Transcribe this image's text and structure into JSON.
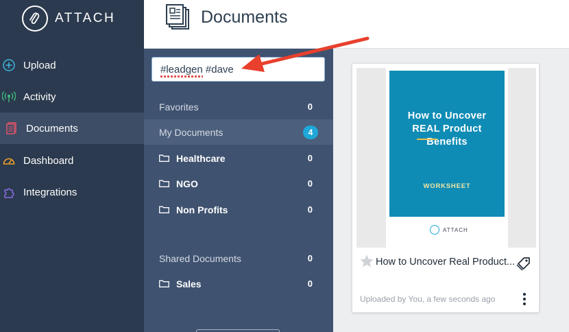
{
  "brand": {
    "name": "ATTACH"
  },
  "nav": {
    "items": [
      {
        "label": "Upload",
        "icon": "plus-circle-icon"
      },
      {
        "label": "Activity",
        "icon": "broadcast-icon"
      },
      {
        "label": "Documents",
        "icon": "documents-icon"
      },
      {
        "label": "Dashboard",
        "icon": "gauge-icon"
      },
      {
        "label": "Integrations",
        "icon": "puzzle-icon"
      }
    ],
    "active": "Documents"
  },
  "header": {
    "title": "Documents",
    "icon": "documents-stack-icon"
  },
  "search": {
    "value": "#leadgen #dave"
  },
  "sidebar": {
    "favorites": {
      "label": "Favorites",
      "count": "0"
    },
    "my_documents": {
      "label": "My Documents",
      "count": "4"
    },
    "folders": [
      {
        "label": "Healthcare",
        "count": "0"
      },
      {
        "label": "NGO",
        "count": "0"
      },
      {
        "label": "Non Profits",
        "count": "0"
      }
    ],
    "shared_documents": {
      "label": "Shared Documents",
      "count": "0"
    },
    "shared_folders": [
      {
        "label": "Sales",
        "count": "0"
      }
    ]
  },
  "document_card": {
    "cover": {
      "title_line1": "How to Uncover",
      "title_line2": "REAL Product",
      "title_line3": "Benefits",
      "subtitle": "WORKSHEET",
      "brand": "ATTACH"
    },
    "title": "How to Uncover Real Product...",
    "meta": "Uploaded by You, a few seconds ago"
  },
  "colors": {
    "nav_bg": "#2b3a4e",
    "panel_bg": "#3f5270",
    "accent": "#1ea7d8",
    "cover_bg": "#0f8cb5",
    "annotation_arrow": "#e8402c"
  }
}
